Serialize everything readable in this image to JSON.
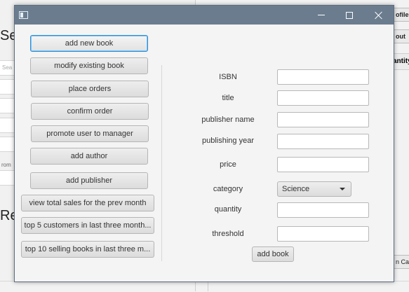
{
  "background": {
    "left_heading_1": "Se",
    "left_heading_2": "Re",
    "search_placeholder": "Sea",
    "from_label": "rom",
    "profile_button": "ofile",
    "logout_button": "out",
    "quantity_header": "antity",
    "cart_button": "n Cart"
  },
  "dialog": {
    "buttons": {
      "add_new_book": "add new book",
      "modify_existing_book": "modify existing book",
      "place_orders": "place orders",
      "confirm_order": "confirm order",
      "promote_user": "promote user to manager",
      "add_author": "add author",
      "add_publisher": "add publisher",
      "view_total_sales": "view total sales for the prev month",
      "top5_customers": "top 5 customers in last three month...",
      "top10_books": "top 10 selling books in last three m..."
    },
    "form": {
      "isbn_label": "ISBN",
      "title_label": "title",
      "publisher_label": "publisher name",
      "year_label": "publishing year",
      "price_label": "price",
      "category_label": "category",
      "category_value": "Science",
      "quantity_label": "quantity",
      "threshold_label": "threshold",
      "add_book_button": "add book"
    }
  },
  "colors": {
    "titlebar": "#6b7c8f",
    "focus_border": "#2f8fd8",
    "dialog_bg": "#f4f4f4"
  },
  "icons": [
    "app-icon",
    "minimize-icon",
    "maximize-icon",
    "close-icon",
    "chevron-down-icon"
  ]
}
